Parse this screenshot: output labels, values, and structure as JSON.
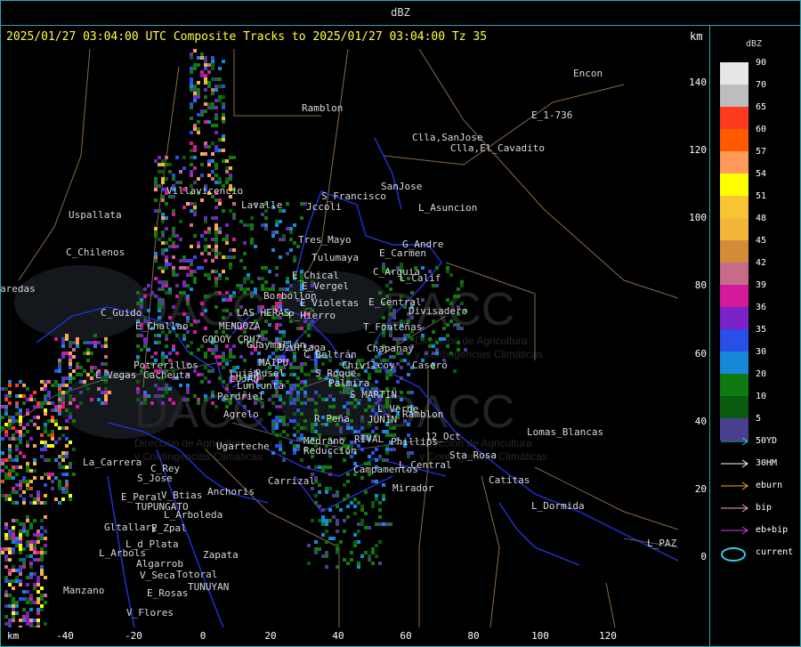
{
  "window_title": "dBZ",
  "header": "2025/01/27 03:04:00 UTC Composite Tracks to 2025/01/27 03:04:00 Tz 35",
  "axis_unit": "km",
  "y_ticks": [
    "140",
    "120",
    "100",
    "80",
    "60",
    "40",
    "20",
    "0"
  ],
  "x_ticks": [
    "-40",
    "-20",
    "0",
    "20",
    "40",
    "60",
    "80",
    "100",
    "120"
  ],
  "x_unit": "km",
  "legend": {
    "title": "dBZ",
    "scale": [
      {
        "label": "90",
        "color": "#e6e6e6"
      },
      {
        "label": "70",
        "color": "#bdbdbd"
      },
      {
        "label": "65",
        "color": "#ff3b1f"
      },
      {
        "label": "60",
        "color": "#ff5a00"
      },
      {
        "label": "57",
        "color": "#ff9a5a"
      },
      {
        "label": "54",
        "color": "#ffff00"
      },
      {
        "label": "51",
        "color": "#f7c531"
      },
      {
        "label": "48",
        "color": "#f2b73a"
      },
      {
        "label": "45",
        "color": "#d58c3a"
      },
      {
        "label": "42",
        "color": "#c86a8a"
      },
      {
        "label": "39",
        "color": "#d6189a"
      },
      {
        "label": "36",
        "color": "#7b23c6"
      },
      {
        "label": "35",
        "color": "#2a4ee8"
      },
      {
        "label": "30",
        "color": "#1787d8"
      },
      {
        "label": "20",
        "color": "#0f7a10"
      },
      {
        "label": "10",
        "color": "#0a5b10"
      },
      {
        "label": "5",
        "color": "#4a3f8e"
      }
    ],
    "tracks": [
      {
        "label": "50YD",
        "color": "#39c6ea",
        "type": "arrow"
      },
      {
        "label": "30HM",
        "color": "#ffffff",
        "type": "arrow"
      },
      {
        "label": "eburn",
        "color": "#f0b030",
        "type": "arrow"
      },
      {
        "label": "bip",
        "color": "#f0b0c0",
        "type": "arrow"
      },
      {
        "label": "eb+bip",
        "color": "#d040e0",
        "type": "arrow"
      },
      {
        "label": "current",
        "color": "#39c6ea",
        "type": "ellipse"
      }
    ]
  },
  "watermarks": [
    "DACC",
    "DACC",
    "DACC",
    "DACC",
    "Dirección de Agricultura",
    "y Contingencias Climáticas",
    "Dirección de Agricultura",
    "y Contingencias Climáticas",
    "Dirección de Agricultura",
    "y Contingencias Climáticas"
  ],
  "towns": [
    "Ramblon",
    "Encon",
    "E_1-736",
    "Clla,SanJose",
    "Clla,El_Cavadito",
    "SanJose",
    "S_Francisco",
    "Jccoli",
    "L_Asuncion",
    "Uspallata",
    "Villavicencio",
    "Lavalle",
    "Tres_Mayo",
    "G_Andre",
    "Tulumaya",
    "E_Carmen",
    "C_Chilenos",
    "E_Chical",
    "C_Arguia",
    "L_Calif",
    "E_Vergel",
    "Borbollon",
    "E_Central",
    "Divisadero",
    "C_Guido",
    "E_Challao",
    "P_Hierro",
    "E_Violetas",
    "LAS HERAS",
    "MENDOZA",
    "GODOY CRUZ",
    "T_Fonteñas",
    "Chapanay",
    "MAIPU",
    "Guaymallén",
    "Uzuriaga",
    "C_Beltrán",
    "Chivilcoy",
    "Casero",
    "Potrerillos",
    "Cacheuta",
    "Rusel",
    "Luján",
    "L_Vegas",
    "LUJAN",
    "Lunlunta",
    "S_Roque",
    "Palmira",
    "S_MARTIN",
    "Perdriel",
    "L_Verde",
    "Ramblon",
    "Agrelo",
    "R_Peña",
    "JUNIN",
    "RIVAL",
    "Phillips",
    "12_Oct",
    "Lomas_Blancas",
    "Medrano",
    "Reducción",
    "Ugarteche",
    "La_Carrera",
    "L_Central",
    "Campamentos",
    "Sta_Rosa",
    "C_Rey",
    "S_Jose",
    "Anchoris",
    "Carrizal",
    "Mirador",
    "Catitas",
    "E_Peral",
    "V_Btias",
    "TUPUNGATO",
    "L_Arboleda",
    "L_Dormida",
    "Gltallary",
    "E_Zpal",
    "L_d_Plata",
    "Zapata",
    "L_PAZ",
    "L_Arbols",
    "Algarrob",
    "Totoral",
    "V_Seca",
    "E_Rosas",
    "TUNUYAN",
    "Manzano",
    "V_Flores",
    "aredas"
  ]
}
